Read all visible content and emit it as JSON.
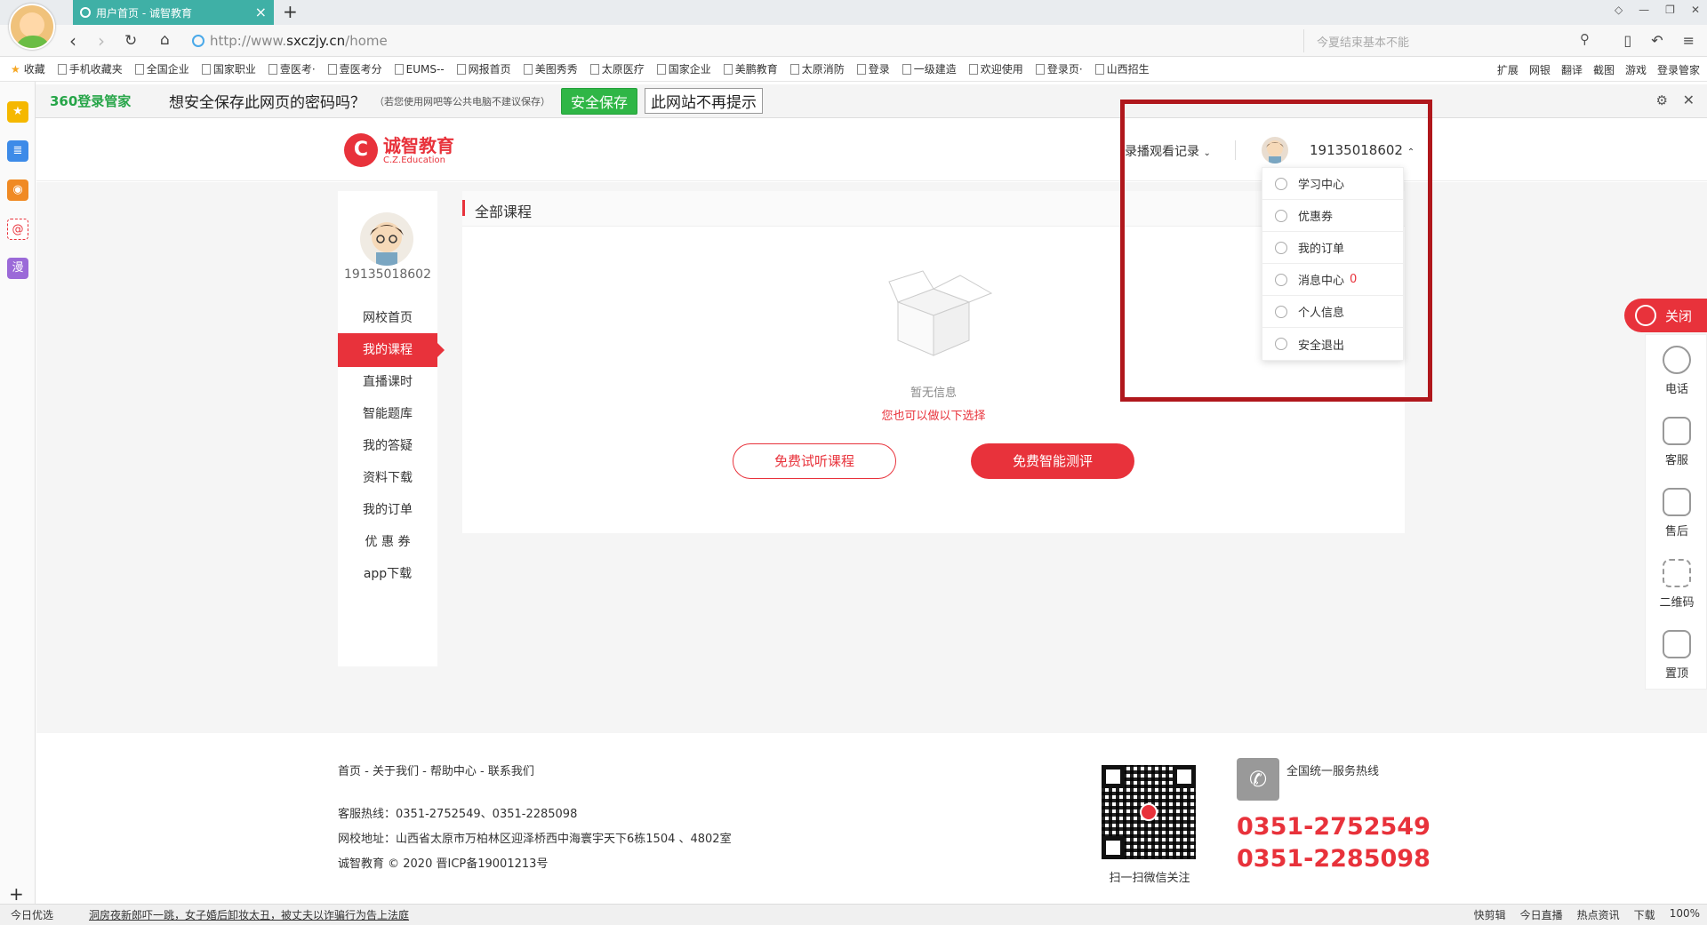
{
  "browser": {
    "tab_title": "用户首页 - 诚智教育",
    "url_prefix": "http://www.",
    "url_host": "sxczjy.cn",
    "url_path": "/home",
    "search_placeholder": "今夏结束基本不能",
    "bookmarks": [
      "收藏",
      "手机收藏夹",
      "全国企业",
      "国家职业",
      "壹医考·",
      "壹医考分",
      "EUMS--",
      "网报首页",
      "美图秀秀",
      "太原医疗",
      "国家企业",
      "美鹏教育",
      "太原消防",
      "登录",
      "一级建造",
      "欢迎使用",
      "登录页·",
      "山西招生"
    ],
    "ext_items": [
      "扩展",
      "网银",
      "翻译",
      "截图",
      "游戏",
      "登录管家"
    ]
  },
  "password_bar": {
    "brand": "360登录管家",
    "question": "想安全保存此网页的密码吗？",
    "note": "（若您使用网吧等公共电脑不建议保存）",
    "save": "安全保存",
    "never": "此网站不再提示"
  },
  "header": {
    "logo_cn": "诚智教育",
    "logo_en": "C.Z.Education",
    "record_menu": "录播观看记录",
    "username": "19135018602"
  },
  "dropdown": {
    "items": [
      {
        "label": "学习中心"
      },
      {
        "label": "优惠券"
      },
      {
        "label": "我的订单"
      },
      {
        "label": "消息中心",
        "count": "0"
      },
      {
        "label": "个人信息"
      },
      {
        "label": "安全退出"
      }
    ]
  },
  "sidebar": {
    "username": "19135018602",
    "items": [
      "网校首页",
      "我的课程",
      "直播课时",
      "智能题库",
      "我的答疑",
      "资料下载",
      "我的订单",
      "优 惠 券",
      "app下载"
    ],
    "active": "我的课程"
  },
  "content": {
    "title": "全部课程",
    "empty_text": "暂无信息",
    "empty_tip": "您也可以做以下选择",
    "btn_trial": "免费试听课程",
    "btn_assess": "免费智能测评"
  },
  "side_tools": {
    "close": "关闭",
    "items": [
      "电话",
      "客服",
      "售后",
      "二维码",
      "置顶"
    ]
  },
  "footer": {
    "links": "首页 - 关于我们 - 帮助中心 - 联系我们",
    "hotline": "客服热线：0351-2752549、0351-2285098",
    "address": "网校地址：山西省太原市万柏林区迎泽桥西中海寰宇天下6栋1504 、4802室",
    "copyright": "诚智教育 © 2020    晋ICP备19001213号",
    "qr_caption": "扫一扫微信关注",
    "hotline_label": "全国统一服务热线",
    "phone1": "0351-2752549",
    "phone2": "0351-2285098"
  },
  "statusbar": {
    "today": "今日优选",
    "news": "洞房夜新郎吓一跳，女子婚后卸妆太丑，被丈夫以诈骗行为告上法庭",
    "right_items": [
      "快剪辑",
      "今日直播",
      "热点资讯",
      "下载",
      "100%"
    ]
  },
  "colors": {
    "brand_red": "#e8323b",
    "highlight_red": "#b0171c",
    "tab_teal": "#3fb0a6",
    "save_green": "#2fb646"
  }
}
